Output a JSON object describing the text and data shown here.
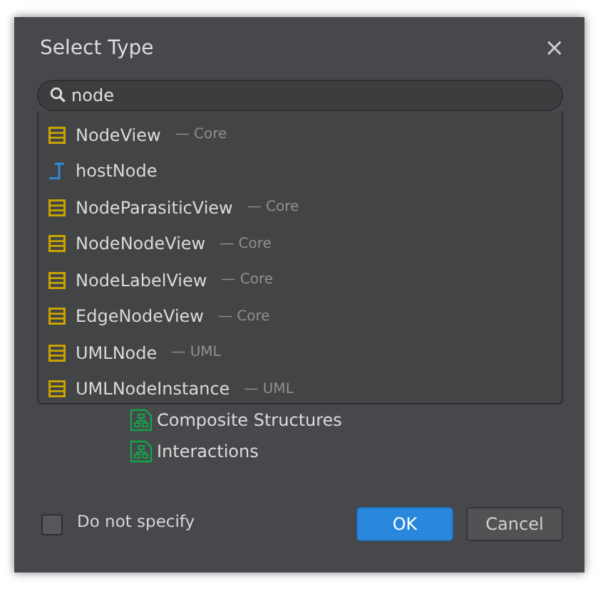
{
  "dialog": {
    "title": "Select Type",
    "close": "×"
  },
  "search": {
    "value": "node"
  },
  "results": [
    {
      "name": "NodeView",
      "module": "— Core",
      "kind": "view"
    },
    {
      "name": "hostNode",
      "kind": "field"
    },
    {
      "name": "NodeParasiticView",
      "module": "— Core",
      "kind": "view"
    },
    {
      "name": "NodeNodeView",
      "module": "— Core",
      "kind": "view"
    },
    {
      "name": "NodeLabelView",
      "module": "— Core",
      "kind": "view"
    },
    {
      "name": "EdgeNodeView",
      "module": "— Core",
      "kind": "view"
    },
    {
      "name": "UMLNode",
      "module": "— UML",
      "kind": "view"
    },
    {
      "name": "UMLNodeInstance",
      "module": "— UML",
      "kind": "view"
    }
  ],
  "tree": [
    {
      "label": "Composite Structures"
    },
    {
      "label": "Interactions"
    }
  ],
  "do_not_specify": {
    "label": "Do not specify",
    "checked": false
  },
  "buttons": [
    {
      "label": "OK",
      "kind": "primary"
    },
    {
      "label": "Cancel",
      "kind": "secondary"
    }
  ]
}
